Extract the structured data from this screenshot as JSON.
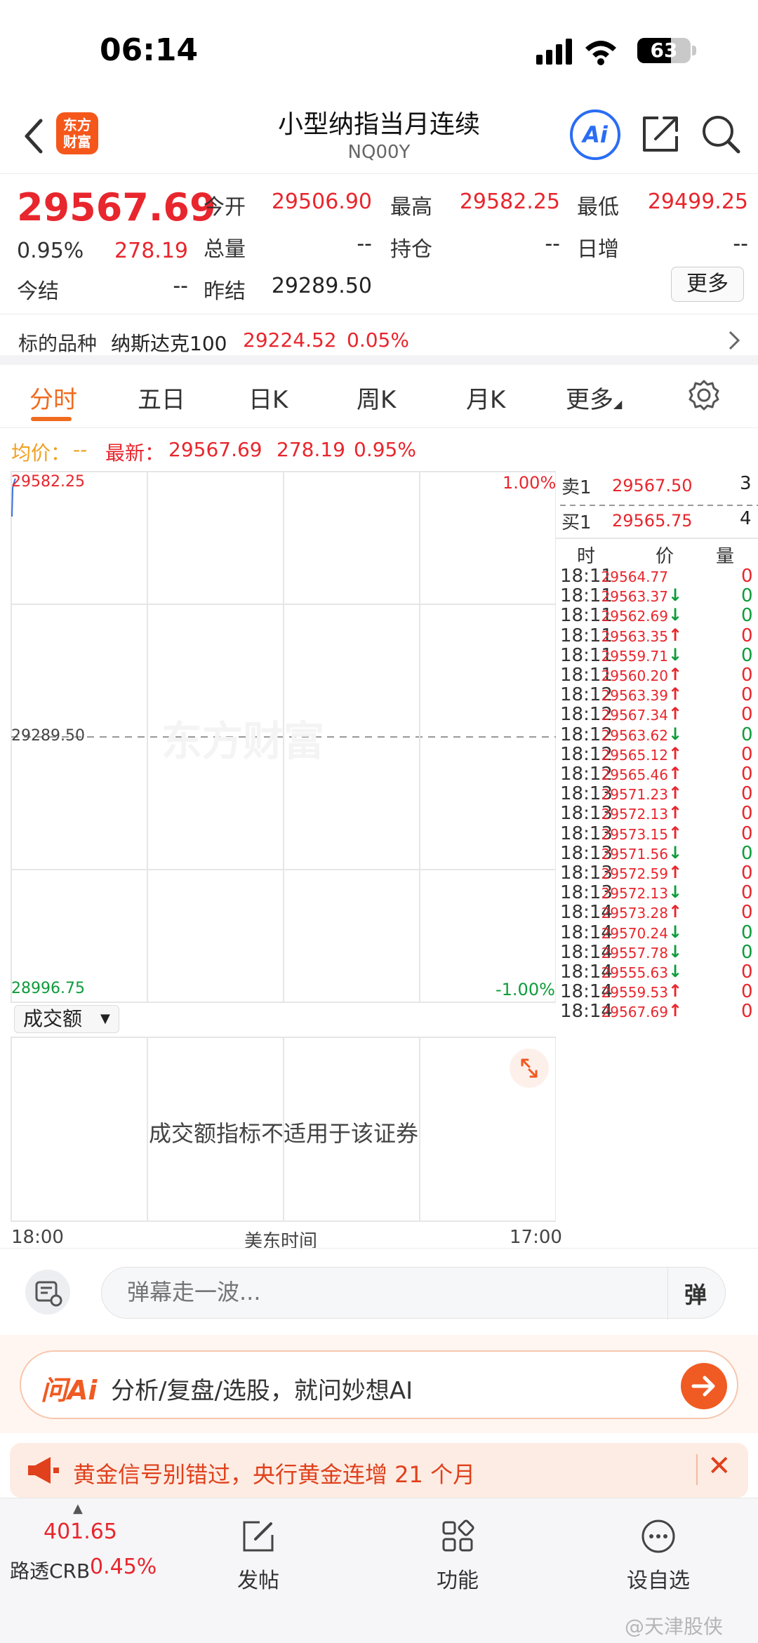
{
  "status": {
    "time": "06:14",
    "battery": "63",
    "battery_level": 0.63
  },
  "nav": {
    "logo_line1": "东方",
    "logo_line2": "财富",
    "title": "小型纳指当月连续",
    "code": "NQ00Y",
    "ai": "Ai"
  },
  "quote": {
    "price": "29567.69",
    "pct": "0.95%",
    "change": "278.19",
    "open_label": "今开",
    "open": "29506.90",
    "high_label": "最高",
    "high": "29582.25",
    "low_label": "最低",
    "low": "29499.25",
    "vol_label": "总量",
    "vol": "--",
    "oi_label": "持仓",
    "oi": "--",
    "daily_label": "日增",
    "daily": "--",
    "settle_label": "今结",
    "settle": "--",
    "prev_label": "昨结",
    "prev": "29289.50",
    "more": "更多"
  },
  "underlying": {
    "label": "标的品种",
    "name": "纳斯达克100",
    "price": "29224.52",
    "pct": "0.05%"
  },
  "tabs": [
    "分时",
    "五日",
    "日K",
    "周K",
    "月K",
    "更多"
  ],
  "avg": {
    "avg_label": "均价：",
    "avg_value": "--",
    "latest_label": "最新：",
    "latest": "29567.69",
    "change": "278.19",
    "pct": "0.95%"
  },
  "chart": {
    "ymax": "29582.25",
    "ymid": "29289.50",
    "ymin": "28996.75",
    "pmax": "1.00%",
    "pmin": "-1.00%",
    "watermark": "东方财富",
    "indicator": "成交额",
    "indicator_msg": "成交额指标不适用于该证券",
    "x_start": "18:00",
    "x_mid": "美东时间",
    "x_end": "17:00"
  },
  "book": {
    "sell_label": "卖1",
    "sell_price": "29567.50",
    "sell_qty": "3",
    "buy_label": "买1",
    "buy_price": "29565.75",
    "buy_qty": "4",
    "col_time": "时",
    "col_price": "价",
    "col_qty": "量",
    "ticks": [
      {
        "t": "18:11",
        "p": "29564.77",
        "d": "",
        "q": "0",
        "c": "red"
      },
      {
        "t": "18:11",
        "p": "29563.37",
        "d": "↓",
        "q": "0",
        "c": "green"
      },
      {
        "t": "18:11",
        "p": "29562.69",
        "d": "↓",
        "q": "0",
        "c": "green"
      },
      {
        "t": "18:11",
        "p": "29563.35",
        "d": "↑",
        "q": "0",
        "c": "red"
      },
      {
        "t": "18:11",
        "p": "29559.71",
        "d": "↓",
        "q": "0",
        "c": "green"
      },
      {
        "t": "18:11",
        "p": "29560.20",
        "d": "↑",
        "q": "0",
        "c": "red"
      },
      {
        "t": "18:12",
        "p": "29563.39",
        "d": "↑",
        "q": "0",
        "c": "red"
      },
      {
        "t": "18:12",
        "p": "29567.34",
        "d": "↑",
        "q": "0",
        "c": "red"
      },
      {
        "t": "18:12",
        "p": "29563.62",
        "d": "↓",
        "q": "0",
        "c": "green"
      },
      {
        "t": "18:12",
        "p": "29565.12",
        "d": "↑",
        "q": "0",
        "c": "red"
      },
      {
        "t": "18:12",
        "p": "29565.46",
        "d": "↑",
        "q": "0",
        "c": "red"
      },
      {
        "t": "18:13",
        "p": "29571.23",
        "d": "↑",
        "q": "0",
        "c": "red"
      },
      {
        "t": "18:13",
        "p": "29572.13",
        "d": "↑",
        "q": "0",
        "c": "red"
      },
      {
        "t": "18:13",
        "p": "29573.15",
        "d": "↑",
        "q": "0",
        "c": "red"
      },
      {
        "t": "18:13",
        "p": "29571.56",
        "d": "↓",
        "q": "0",
        "c": "green"
      },
      {
        "t": "18:13",
        "p": "29572.59",
        "d": "↑",
        "q": "0",
        "c": "red"
      },
      {
        "t": "18:13",
        "p": "29572.13",
        "d": "↓",
        "q": "0",
        "c": "red"
      },
      {
        "t": "18:14",
        "p": "29573.28",
        "d": "↑",
        "q": "0",
        "c": "red"
      },
      {
        "t": "18:14",
        "p": "29570.24",
        "d": "↓",
        "q": "0",
        "c": "green"
      },
      {
        "t": "18:14",
        "p": "29557.78",
        "d": "↓",
        "q": "0",
        "c": "green"
      },
      {
        "t": "18:14",
        "p": "29555.63",
        "d": "↓",
        "q": "0",
        "c": "red"
      },
      {
        "t": "18:14",
        "p": "29559.53",
        "d": "↑",
        "q": "0",
        "c": "red"
      },
      {
        "t": "18:14",
        "p": "29567.69",
        "d": "↑",
        "q": "0",
        "c": "red"
      }
    ]
  },
  "input": {
    "placeholder": "弹幕走一波...",
    "danmu_btn": "弹"
  },
  "ai_bar": {
    "logo": "问Ai",
    "text": "分析/复盘/选股，就问妙想AI"
  },
  "banner": {
    "text": "黄金信号别错过，央行黄金连增 21 个月",
    "close": "✕"
  },
  "bottom": {
    "index_value": "401.65",
    "index_name": "路透CRB",
    "index_pct": "0.45%",
    "post": "发帖",
    "func": "功能",
    "watch": "设自选"
  },
  "watermark": "@天津股侠",
  "colors": {
    "up": "#e8262d",
    "down": "#0e9c3a",
    "accent": "#f06b1f",
    "ai_blue": "#2a6df4"
  }
}
